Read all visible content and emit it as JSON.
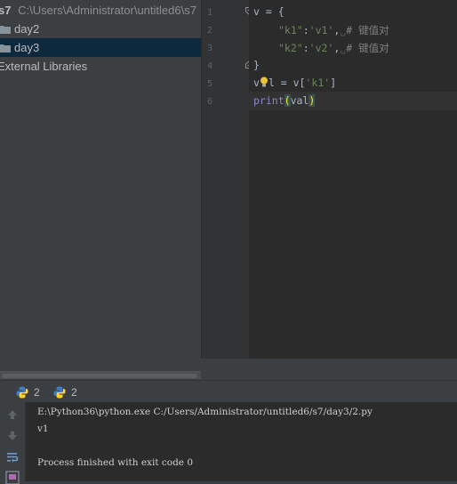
{
  "project_tree": {
    "root_name": "s7",
    "root_path": "C:\\Users\\Administrator\\untitled6\\s7",
    "items": [
      {
        "label": "day2"
      },
      {
        "label": "day3"
      }
    ],
    "external_libraries": "External Libraries"
  },
  "editor": {
    "line_numbers": [
      "1",
      "2",
      "3",
      "4",
      "5",
      "6"
    ],
    "code": {
      "l1": "v = {",
      "l2_key": "\"k1\"",
      "l2_colon": ":",
      "l2_val": "'v1'",
      "l2_comma": ",",
      "l2_comment": "# 键值对",
      "l3_key": "\"k2\"",
      "l3_colon": ":",
      "l3_val": "'v2'",
      "l3_comma": ",",
      "l3_comment": "# 键值对",
      "l4": "}",
      "l5_a": "v",
      "l5_b": "l = v[",
      "l5_key": "'k1'",
      "l5_c": "]",
      "l6_func": "print",
      "l6_open": "(",
      "l6_arg": "val",
      "l6_close": ")"
    }
  },
  "run_panel": {
    "tabs": [
      {
        "label": "2"
      },
      {
        "label": "2"
      }
    ],
    "console": [
      "E:\\Python36\\python.exe C:/Users/Administrator/untitled6/s7/day3/2.py",
      "v1",
      "Process finished with exit code 0"
    ]
  },
  "colors": {
    "selected_row": "#0d293e",
    "string": "#6a8759",
    "comment": "#808080",
    "builtin": "#8888c6",
    "python_blue": "#3f7fbf",
    "python_yellow": "#ffd43b"
  }
}
